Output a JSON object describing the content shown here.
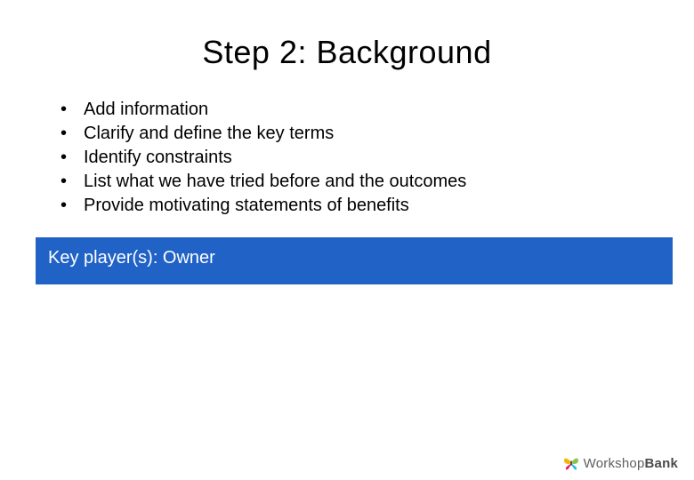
{
  "title": "Step 2: Background",
  "bullets": [
    "Add information",
    "Clarify and define the key terms",
    "Identify constraints",
    "List what we have tried before and the outcomes",
    "Provide motivating statements of benefits"
  ],
  "key_banner": "Key player(s): Owner",
  "brand": {
    "prefix": "Workshop",
    "suffix": "Bank"
  },
  "colors": {
    "banner_bg": "#2062c6",
    "banner_fg": "#ffffff"
  }
}
